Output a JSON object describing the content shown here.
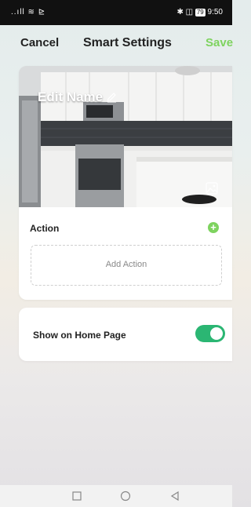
{
  "status_bar": {
    "left": "..ıll ≋ ⊵",
    "right_prefix": "✱ ◫ ",
    "battery": "79",
    "time": "9:50"
  },
  "nav": {
    "cancel_label": "Cancel",
    "title": "Smart Settings",
    "save_label": "Save"
  },
  "cover": {
    "name_label": "Edit Name"
  },
  "action": {
    "label": "Action",
    "add_label": "Add Action"
  },
  "home_page": {
    "label": "Show on Home Page",
    "enabled": true
  },
  "colors": {
    "accent_green": "#7ed35f",
    "toggle_green": "#2bb673"
  },
  "icons": [
    "pencil-icon",
    "image-icon",
    "plus-icon",
    "square-icon",
    "circle-icon",
    "triangle-back-icon"
  ]
}
